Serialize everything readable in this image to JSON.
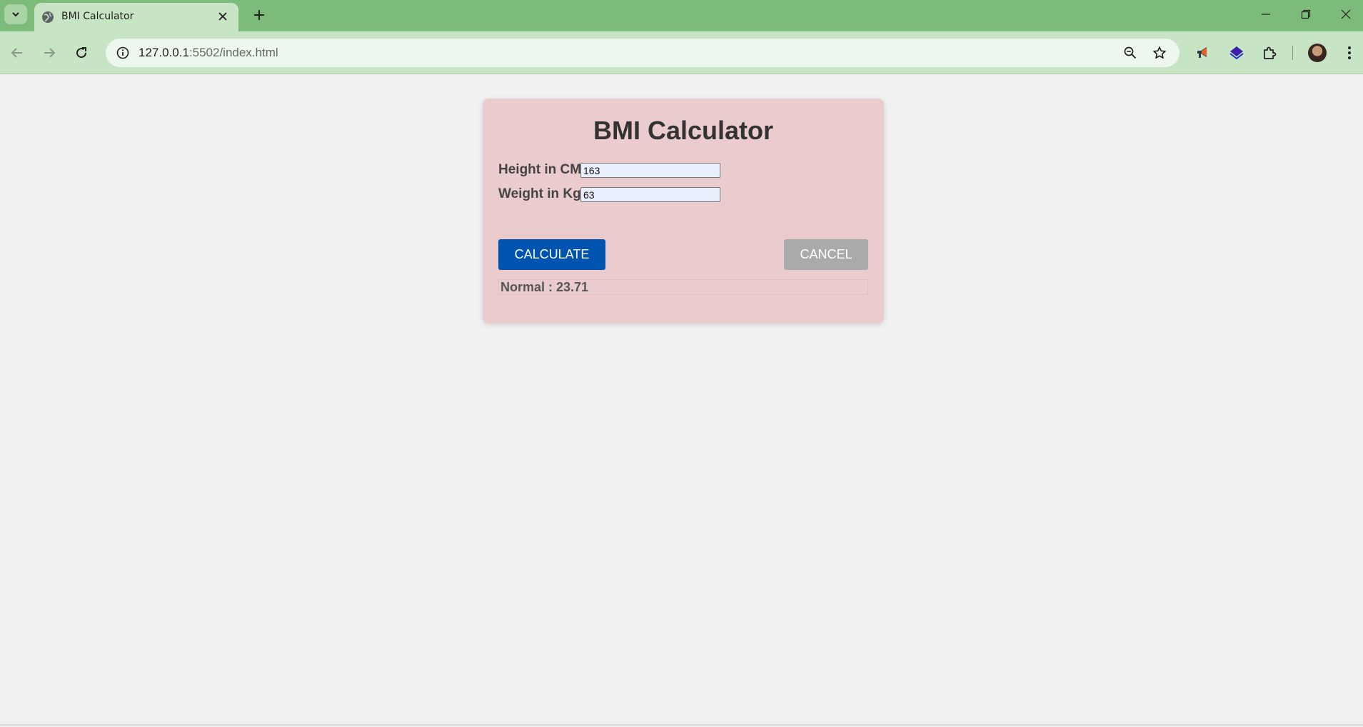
{
  "browser": {
    "tab_title": "BMI Calculator",
    "url_host": "127.0.0.1",
    "url_path": ":5502/index.html",
    "accent_color": "#7dbb7a",
    "icons": [
      "tab-search-icon",
      "globe-icon",
      "close-icon",
      "plus-icon",
      "minimize-icon",
      "restore-icon",
      "close-window-icon",
      "back-icon",
      "forward-icon",
      "reload-icon",
      "site-info-icon",
      "zoom-out-icon",
      "star-icon",
      "megaphone-icon",
      "extension-layers-icon",
      "puzzle-icon",
      "profile-avatar",
      "kebab-menu-icon"
    ]
  },
  "app": {
    "title": "BMI Calculator",
    "height_label": "Height in CM",
    "height_value": "163",
    "weight_label": "Weight in Kg",
    "weight_value": "63",
    "calculate_label": "CALCULATE",
    "cancel_label": "CANCEL",
    "result_text": "Normal : 23.71",
    "card_color": "#ebccce",
    "calculate_color": "#0054b0",
    "cancel_color": "#aaaaaa"
  }
}
